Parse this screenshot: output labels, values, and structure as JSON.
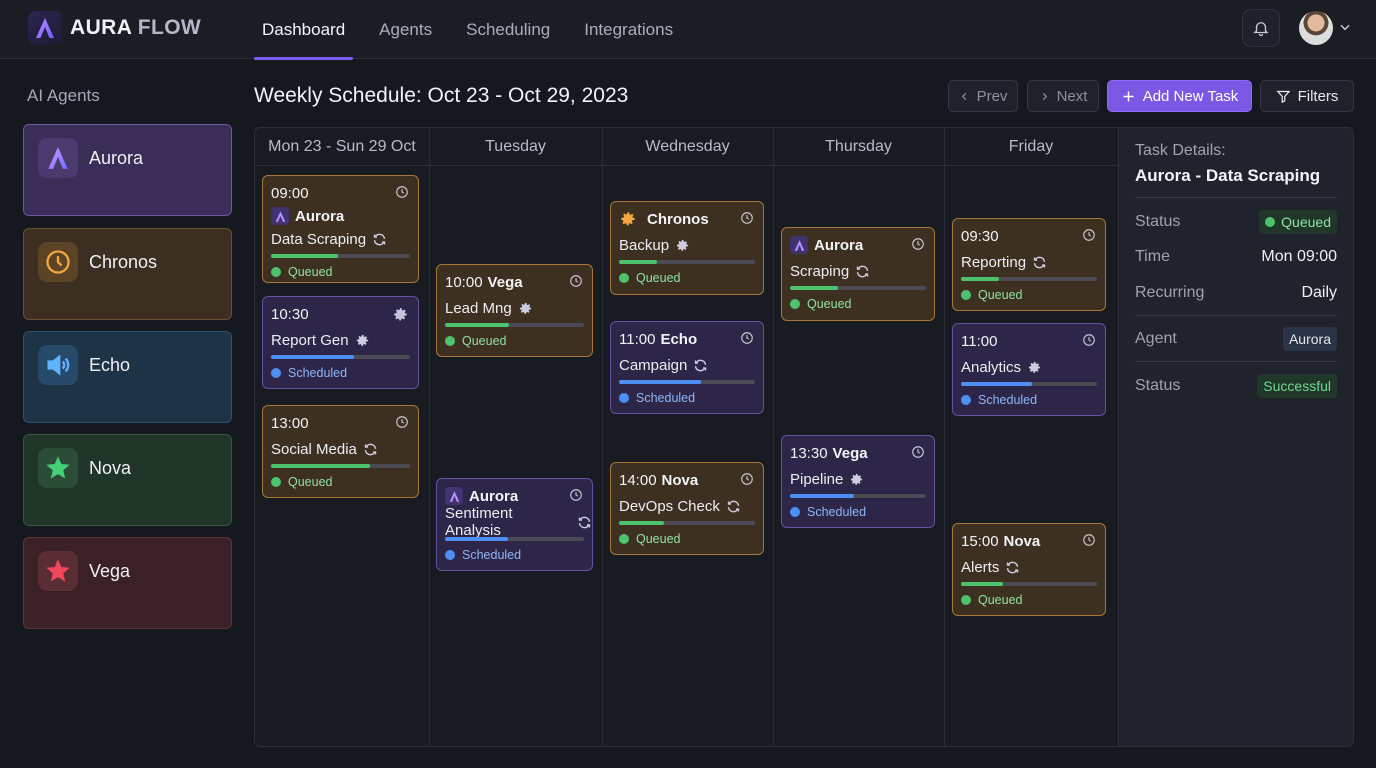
{
  "app": {
    "logo_word1": "AURA",
    "logo_word2": "FLOW"
  },
  "nav": [
    "Dashboard",
    "Agents",
    "Scheduling",
    "Integrations"
  ],
  "sidebar": {
    "title": "AI Agents",
    "agents": [
      {
        "name": "Aurora",
        "icon": "aurora-logo-icon"
      },
      {
        "name": "Chronos",
        "icon": "clock-icon"
      },
      {
        "name": "Echo",
        "icon": "speaker-icon"
      },
      {
        "name": "Nova",
        "icon": "star-icon"
      },
      {
        "name": "Vega",
        "icon": "star-icon"
      }
    ]
  },
  "schedule": {
    "title": "Weekly Schedule: Oct 23 - Oct 29, 2023",
    "prev": "Prev",
    "next": "Next",
    "add_task": "Add New Task",
    "filters": "Filters",
    "columns": [
      "Mon 23 - Sun 29 Oct",
      "Tuesday",
      "Wednesday",
      "Thursday",
      "Friday"
    ]
  },
  "tasks": [
    {
      "time": "09:00",
      "agent": "Aurora",
      "name": "Data Scraping",
      "status": "Queued",
      "progress": 0.48
    },
    {
      "time": "10:30",
      "agent": "",
      "name": "Report Gen",
      "status": "Scheduled",
      "progress": 0.6
    },
    {
      "time": "13:00",
      "agent": "",
      "name": "Social Media",
      "status": "Queued",
      "progress": 0.71
    },
    {
      "time": "10:00",
      "agent": "Vega",
      "name": "Lead Mng",
      "status": "Queued",
      "progress": 0.46
    },
    {
      "time": "",
      "agent": "Aurora",
      "name": "Sentiment Analysis",
      "status": "Scheduled",
      "progress": 0.45
    },
    {
      "time": "",
      "agent": "Chronos",
      "name": "Backup",
      "status": "Queued",
      "progress": 0.28
    },
    {
      "time": "11:00",
      "agent": "Echo",
      "name": "Campaign",
      "status": "Scheduled",
      "progress": 0.6
    },
    {
      "time": "14:00",
      "agent": "Nova",
      "name": "DevOps Check",
      "status": "Queued",
      "progress": 0.33
    },
    {
      "time": "",
      "agent": "Aurora",
      "name": "Scraping",
      "status": "Queued",
      "progress": 0.35
    },
    {
      "time": "13:30",
      "agent": "Vega",
      "name": "Pipeline",
      "status": "Scheduled",
      "progress": 0.47
    },
    {
      "time": "09:30",
      "agent": "",
      "name": "Reporting",
      "status": "Queued",
      "progress": 0.28
    },
    {
      "time": "11:00",
      "agent": "",
      "name": "Analytics",
      "status": "Scheduled",
      "progress": 0.52
    },
    {
      "time": "15:00",
      "agent": "Nova",
      "name": "Alerts",
      "status": "Queued",
      "progress": 0.31
    }
  ],
  "details": {
    "heading": "Task Details:",
    "task": "Aurora - Data Scraping",
    "status_label": "Status",
    "status_value": "Queued",
    "time_label": "Time",
    "time_value": "Mon 09:00",
    "recurring_label": "Recurring",
    "recurring_value": "Daily",
    "agent_label": "Agent",
    "agent_value": "Aurora",
    "status2_label": "Status",
    "status2_value": "Successful"
  },
  "colors": {
    "accent": "#7b57e3",
    "queued": "#4cc36c",
    "scheduled": "#4d8ff2",
    "orange_border": "#a7773a",
    "purple_border": "#6451a4"
  }
}
